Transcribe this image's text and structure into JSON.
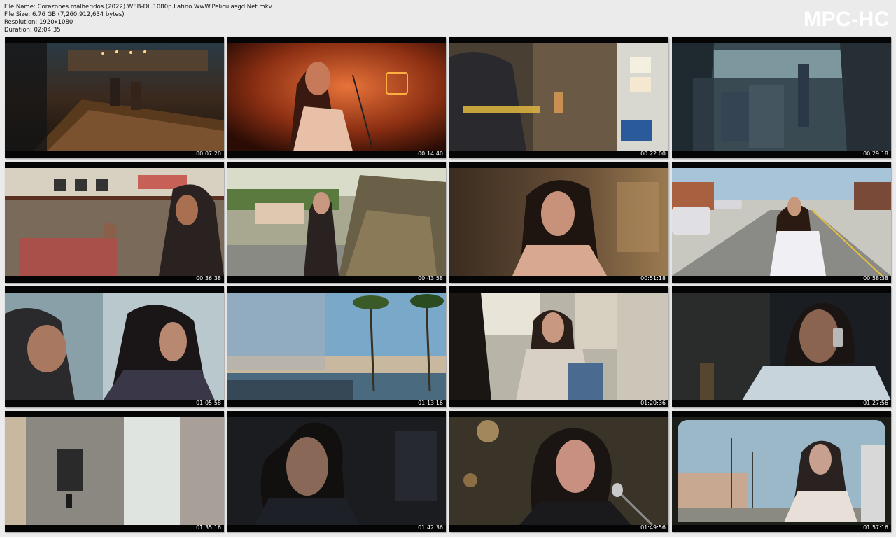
{
  "info": {
    "file_name": "File Name: Corazones.malheridos.(2022).WEB-DL.1080p.Latino.WwW.Peliculasgd.Net.mkv",
    "file_size": "File Size: 6.76 GB (7,260,912,634 bytes)",
    "resolution": "Resolution: 1920x1080",
    "duration": "Duration: 02:04:35"
  },
  "logo": "MPC-HC",
  "colors": {
    "background": "#ebebeb",
    "logo": "#ffffff",
    "frame": "#050505"
  },
  "thumbnails": [
    {
      "timestamp": "00:07:20",
      "scene": "bar interior"
    },
    {
      "timestamp": "00:14:40",
      "scene": "singer on stage"
    },
    {
      "timestamp": "00:22:00",
      "scene": "garage shop"
    },
    {
      "timestamp": "00:29:18",
      "scene": "bus interior"
    },
    {
      "timestamp": "00:36:38",
      "scene": "diner"
    },
    {
      "timestamp": "00:43:58",
      "scene": "street with soldiers"
    },
    {
      "timestamp": "00:51:18",
      "scene": "woman indoors"
    },
    {
      "timestamp": "00:58:38",
      "scene": "woman on phone street"
    },
    {
      "timestamp": "01:05:58",
      "scene": "two people talking"
    },
    {
      "timestamp": "01:13:16",
      "scene": "harbor view"
    },
    {
      "timestamp": "01:20:36",
      "scene": "cafe table"
    },
    {
      "timestamp": "01:27:56",
      "scene": "man on phone"
    },
    {
      "timestamp": "01:35:16",
      "scene": "hallway"
    },
    {
      "timestamp": "01:42:36",
      "scene": "man close-up"
    },
    {
      "timestamp": "01:49:56",
      "scene": "singer at microphone"
    },
    {
      "timestamp": "01:57:16",
      "scene": "vintage street"
    }
  ]
}
